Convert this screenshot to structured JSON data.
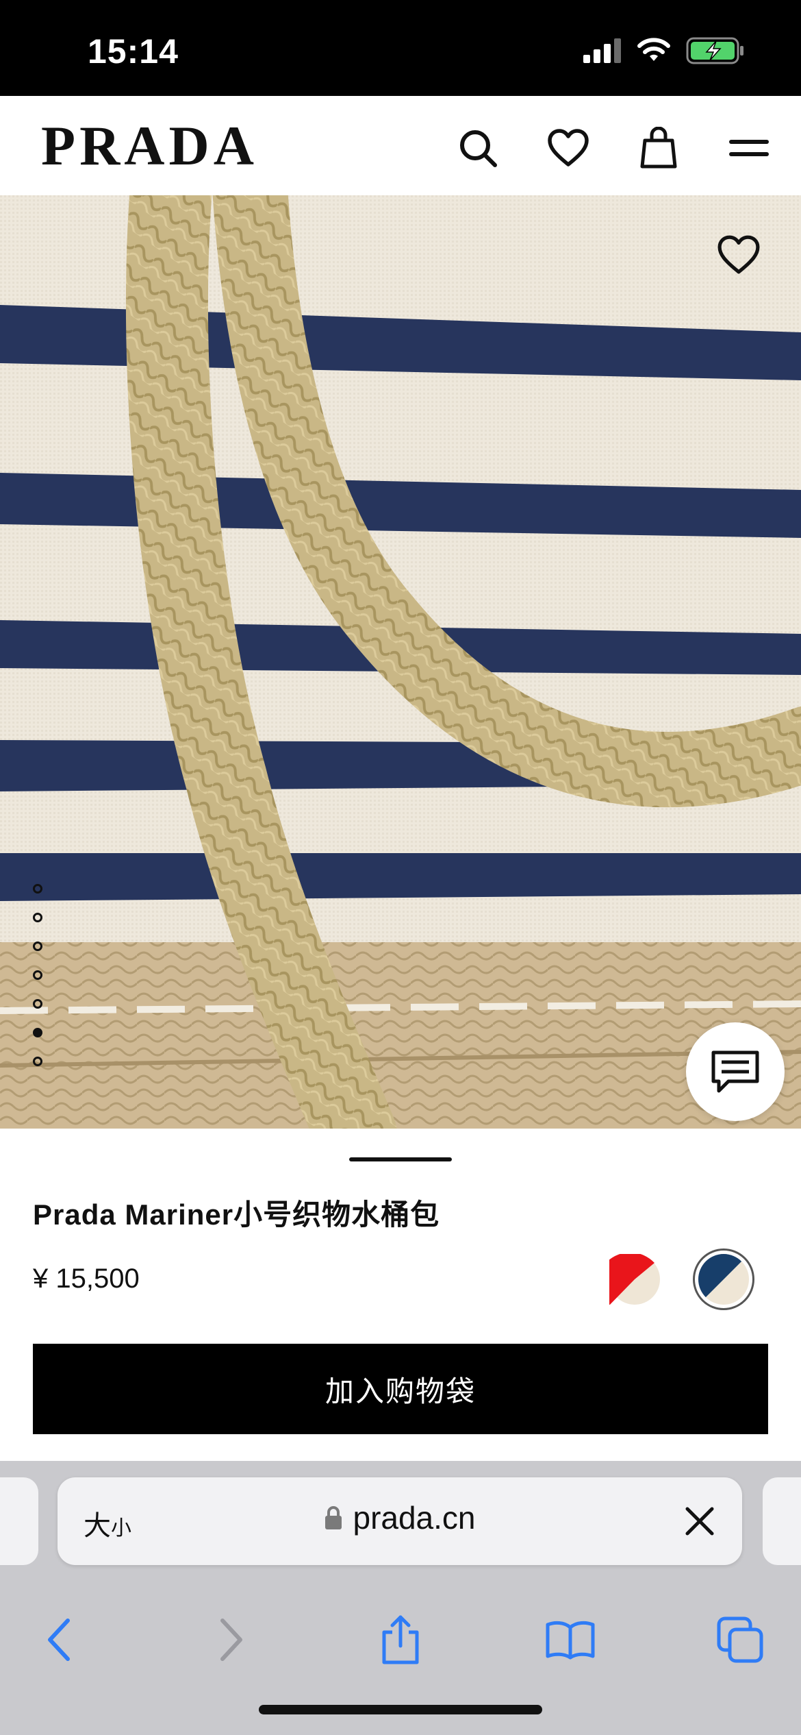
{
  "status_bar": {
    "time": "15:14"
  },
  "header": {
    "logo": "PRADA"
  },
  "gallery": {
    "dot_count": 7,
    "active_index": 5
  },
  "product": {
    "title": "Prada Mariner小号织物水桶包",
    "price": "¥ 15,500",
    "swatches": [
      {
        "name": "red-cream",
        "color_a": "#e9151b",
        "color_b": "#efe6d6",
        "selected": false
      },
      {
        "name": "navy-cream",
        "color_a": "#173e6a",
        "color_b": "#efe6d6",
        "selected": true
      }
    ],
    "add_to_bag_label": "加入购物袋"
  },
  "browser": {
    "text_size_big": "大",
    "text_size_small": "小",
    "url": "prada.cn"
  },
  "colors": {
    "accent_blue": "#2f7cf6",
    "stripe_navy": "#26345c",
    "canvas_cream": "#efe9dd",
    "rope_tan": "#c7b583"
  }
}
